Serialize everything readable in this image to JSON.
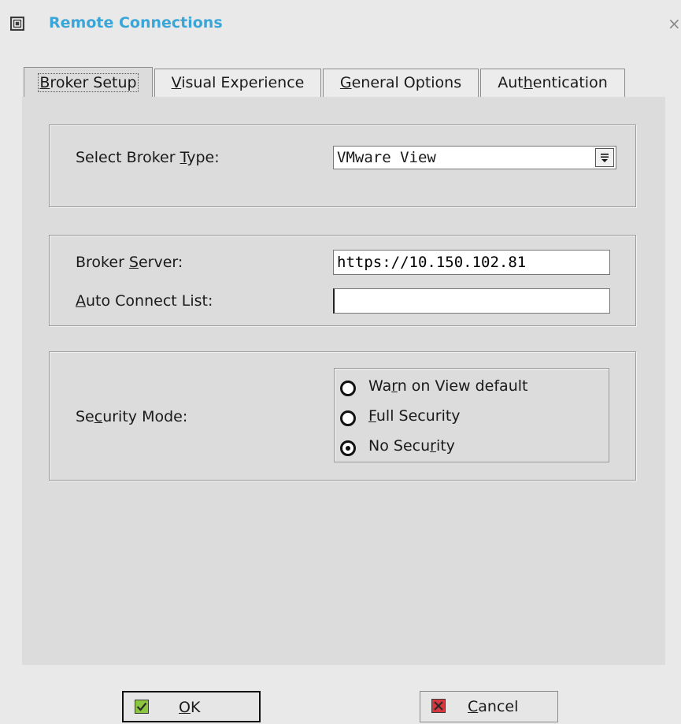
{
  "window": {
    "title": "Remote Connections",
    "title_color": "#3aa6d8",
    "icon": "window-app-icon",
    "close_icon": "close-icon"
  },
  "tabs": [
    {
      "label_pre": "",
      "label_key": "B",
      "label_post": "roker Setup",
      "active": true
    },
    {
      "label_pre": "",
      "label_key": "V",
      "label_post": "isual Experience",
      "active": false
    },
    {
      "label_pre": "",
      "label_key": "G",
      "label_post": "eneral Options",
      "active": false
    },
    {
      "label_pre": "Aut",
      "label_key": "h",
      "label_post": "entication",
      "active": false
    }
  ],
  "broker_type": {
    "label_pre": "Select Broker ",
    "label_key": "T",
    "label_post": "ype:",
    "selected": "VMware View",
    "dropdown_icon": "dropdown-arrow-icon"
  },
  "broker_server": {
    "label_pre": "Broker ",
    "label_key": "S",
    "label_post": "erver:",
    "value": "https://10.150.102.81"
  },
  "auto_connect": {
    "label_pre": "",
    "label_key": "A",
    "label_post": "uto Connect List:",
    "value": ""
  },
  "security_mode": {
    "label_pre": "Se",
    "label_key": "c",
    "label_post": "urity Mode:",
    "options": [
      {
        "pre": "Wa",
        "key": "r",
        "post": "n on View default",
        "selected": false
      },
      {
        "pre": "",
        "key": "F",
        "post": "ull Security",
        "selected": false
      },
      {
        "pre": "No Secu",
        "key": "r",
        "post": "ity",
        "selected": true
      }
    ]
  },
  "buttons": {
    "ok": {
      "pre": "",
      "key": "O",
      "post": "K",
      "icon": "check-icon",
      "icon_color": "#8cc63f"
    },
    "cancel": {
      "pre": "",
      "key": "C",
      "post": "ancel",
      "icon": "cancel-x-icon",
      "icon_color": "#d9363e"
    }
  }
}
